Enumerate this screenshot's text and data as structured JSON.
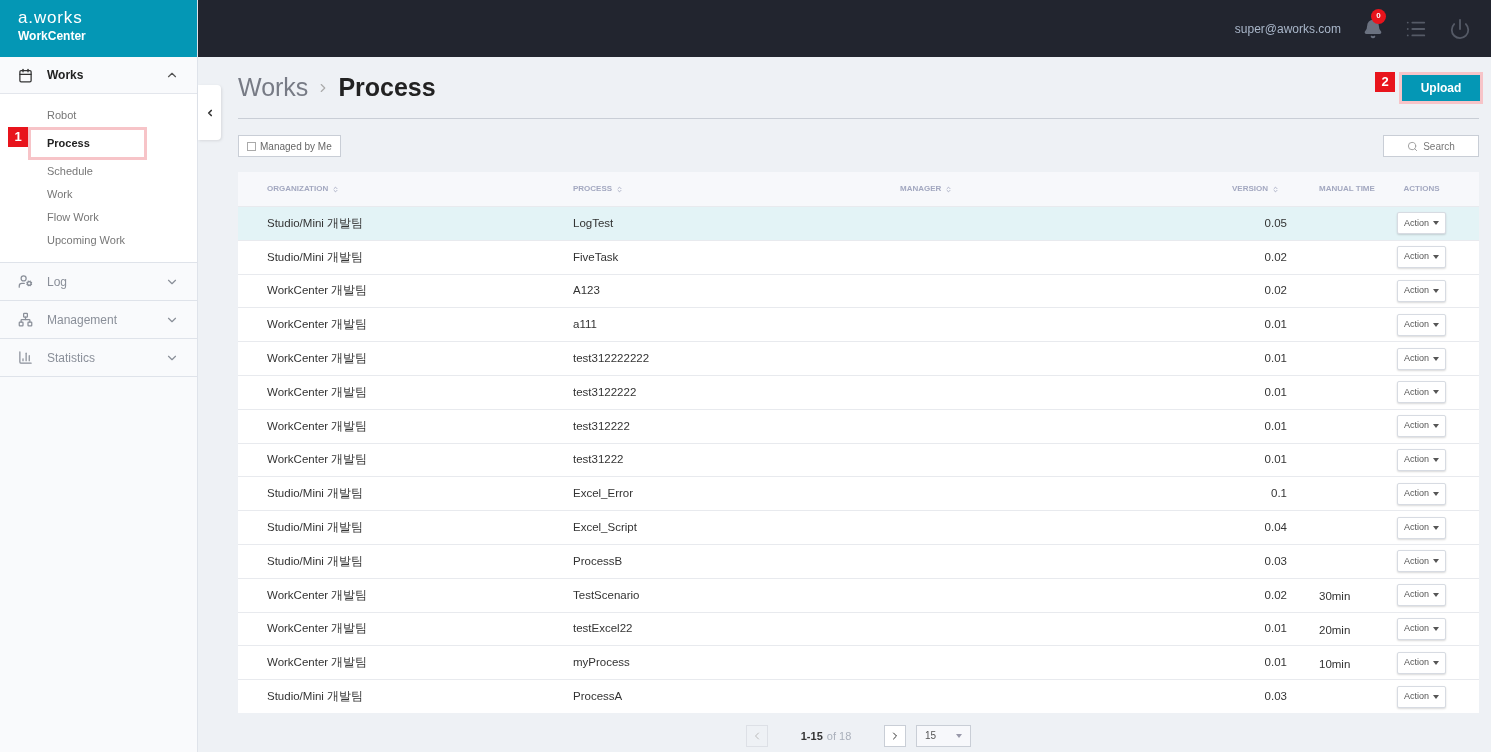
{
  "brand": {
    "logo": "a.works",
    "product": "WorkCenter"
  },
  "header": {
    "user": "super@aworks.com",
    "notifications": "0"
  },
  "sidebar": {
    "sections": [
      {
        "label": "Works",
        "expanded": true,
        "items": [
          {
            "label": "Robot",
            "selected": false
          },
          {
            "label": "Process",
            "selected": true,
            "callout": "1"
          },
          {
            "label": "Schedule",
            "selected": false
          },
          {
            "label": "Work",
            "selected": false
          },
          {
            "label": "Flow Work",
            "selected": false
          },
          {
            "label": "Upcoming Work",
            "selected": false
          }
        ]
      },
      {
        "label": "Log",
        "expanded": false
      },
      {
        "label": "Management",
        "expanded": false
      },
      {
        "label": "Statistics",
        "expanded": false
      }
    ]
  },
  "breadcrumb": {
    "parent": "Works",
    "current": "Process"
  },
  "upload_button": {
    "label": "Upload",
    "callout": "2"
  },
  "filter": {
    "label": "Managed by Me",
    "checked": false
  },
  "search_button": {
    "label": "Search"
  },
  "table": {
    "columns": [
      {
        "label": "ORGANIZATION",
        "sortable": true
      },
      {
        "label": "PROCESS",
        "sortable": true
      },
      {
        "label": "MANAGER",
        "sortable": true
      },
      {
        "label": "VERSION",
        "sortable": true
      },
      {
        "label": "MANUAL TIME",
        "sortable": false
      },
      {
        "label": "ACTIONS",
        "sortable": false
      }
    ],
    "rows": [
      {
        "organization": "Studio/Mini 개발팀",
        "process": "LogTest",
        "version": "0.05",
        "manual_time": "",
        "action": "Action",
        "selected": true
      },
      {
        "organization": "Studio/Mini 개발팀",
        "process": "FiveTask",
        "version": "0.02",
        "manual_time": "",
        "action": "Action",
        "selected": false
      },
      {
        "organization": "WorkCenter 개발팀",
        "process": "A123",
        "version": "0.02",
        "manual_time": "",
        "action": "Action",
        "selected": false
      },
      {
        "organization": "WorkCenter 개발팀",
        "process": "a111",
        "version": "0.01",
        "manual_time": "",
        "action": "Action",
        "selected": false
      },
      {
        "organization": "WorkCenter 개발팀",
        "process": "test312222222",
        "version": "0.01",
        "manual_time": "",
        "action": "Action",
        "selected": false
      },
      {
        "organization": "WorkCenter 개발팀",
        "process": "test3122222",
        "version": "0.01",
        "manual_time": "",
        "action": "Action",
        "selected": false
      },
      {
        "organization": "WorkCenter 개발팀",
        "process": "test312222",
        "version": "0.01",
        "manual_time": "",
        "action": "Action",
        "selected": false
      },
      {
        "organization": "WorkCenter 개발팀",
        "process": "test31222",
        "version": "0.01",
        "manual_time": "",
        "action": "Action",
        "selected": false
      },
      {
        "organization": "Studio/Mini 개발팀",
        "process": "Excel_Error",
        "version": "0.1",
        "manual_time": "",
        "action": "Action",
        "selected": false
      },
      {
        "organization": "Studio/Mini 개발팀",
        "process": "Excel_Script",
        "version": "0.04",
        "manual_time": "",
        "action": "Action",
        "selected": false
      },
      {
        "organization": "Studio/Mini 개발팀",
        "process": "ProcessB",
        "version": "0.03",
        "manual_time": "",
        "action": "Action",
        "selected": false
      },
      {
        "organization": "WorkCenter 개발팀",
        "process": "TestScenario",
        "version": "0.02",
        "manual_time": "30min",
        "action": "Action",
        "selected": false
      },
      {
        "organization": "WorkCenter 개발팀",
        "process": "testExcel22",
        "version": "0.01",
        "manual_time": "20min",
        "action": "Action",
        "selected": false
      },
      {
        "organization": "WorkCenter 개발팀",
        "process": "myProcess",
        "version": "0.01",
        "manual_time": "10min",
        "action": "Action",
        "selected": false
      },
      {
        "organization": "Studio/Mini 개발팀",
        "process": "ProcessA",
        "version": "0.03",
        "manual_time": "",
        "action": "Action",
        "selected": false
      }
    ]
  },
  "pagination": {
    "range": "1-15",
    "total": "of 18",
    "prev_disabled": true,
    "next_disabled": false,
    "page_size": "15"
  }
}
